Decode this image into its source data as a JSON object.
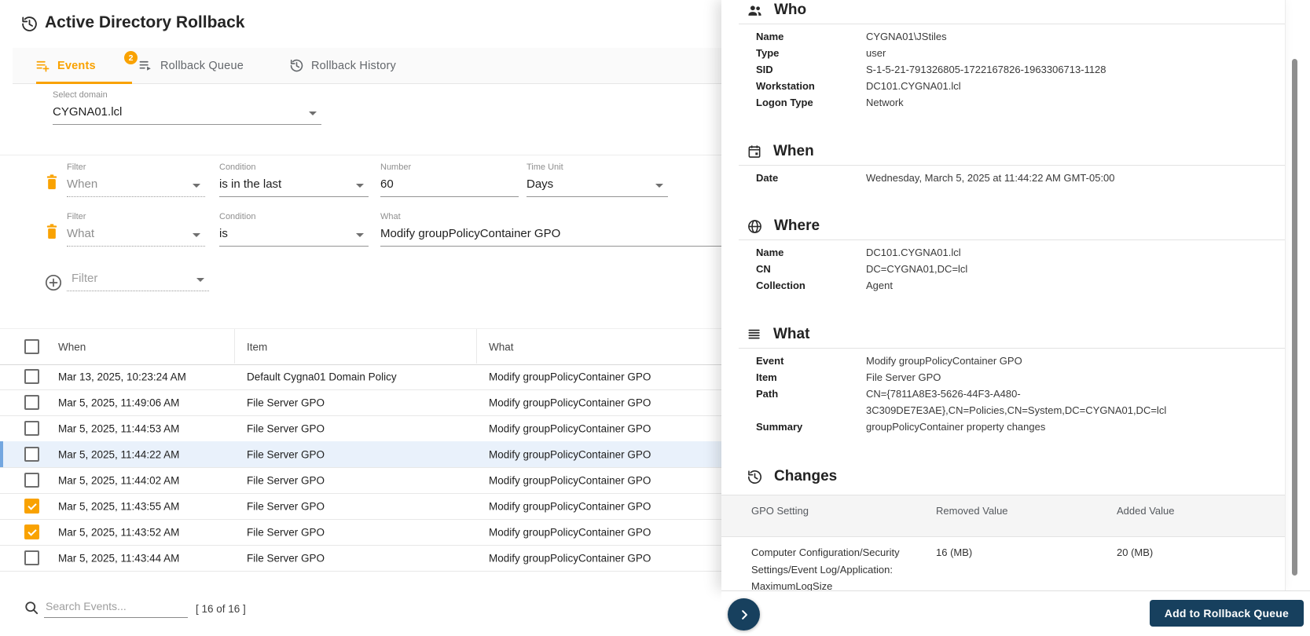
{
  "header": {
    "title": "Active Directory Rollback"
  },
  "tabs": {
    "events": "Events",
    "queue": "Rollback Queue",
    "queue_badge": "2",
    "history": "Rollback History"
  },
  "filters": {
    "domain": {
      "label": "Select domain",
      "value": "CYGNA01.lcl"
    },
    "row1": {
      "filter_label": "Filter",
      "filter_value": "When",
      "condition_label": "Condition",
      "condition_value": "is in the last",
      "number_label": "Number",
      "number_value": "60",
      "unit_label": "Time Unit",
      "unit_value": "Days"
    },
    "row2": {
      "filter_label": "Filter",
      "filter_value": "What",
      "condition_label": "Condition",
      "condition_value": "is",
      "what_label": "What",
      "what_value": "Modify groupPolicyContainer GPO"
    },
    "add_label": "Filter"
  },
  "events": {
    "columns": {
      "when": "When",
      "item": "Item",
      "what": "What"
    },
    "rows": [
      {
        "when": "Mar 13, 2025, 10:23:24 AM",
        "item": "Default Cygna01 Domain Policy",
        "what": "Modify groupPolicyContainer GPO",
        "checked": false,
        "selected": false
      },
      {
        "when": "Mar 5, 2025, 11:49:06 AM",
        "item": "File Server GPO",
        "what": "Modify groupPolicyContainer GPO",
        "checked": false,
        "selected": false
      },
      {
        "when": "Mar 5, 2025, 11:44:53 AM",
        "item": "File Server GPO",
        "what": "Modify groupPolicyContainer GPO",
        "checked": false,
        "selected": false
      },
      {
        "when": "Mar 5, 2025, 11:44:22 AM",
        "item": "File Server GPO",
        "what": "Modify groupPolicyContainer GPO",
        "checked": false,
        "selected": true
      },
      {
        "when": "Mar 5, 2025, 11:44:02 AM",
        "item": "File Server GPO",
        "what": "Modify groupPolicyContainer GPO",
        "checked": false,
        "selected": false
      },
      {
        "when": "Mar 5, 2025, 11:43:55 AM",
        "item": "File Server GPO",
        "what": "Modify groupPolicyContainer GPO",
        "checked": true,
        "selected": false
      },
      {
        "when": "Mar 5, 2025, 11:43:52 AM",
        "item": "File Server GPO",
        "what": "Modify groupPolicyContainer GPO",
        "checked": true,
        "selected": false
      },
      {
        "when": "Mar 5, 2025, 11:43:44 AM",
        "item": "File Server GPO",
        "what": "Modify groupPolicyContainer GPO",
        "checked": false,
        "selected": false
      }
    ],
    "search_placeholder": "Search Events...",
    "count": "[ 16 of 16 ]"
  },
  "details": {
    "who": {
      "heading": "Who",
      "rows": [
        {
          "label": "Name",
          "value": "CYGNA01\\JStiles"
        },
        {
          "label": "Type",
          "value": "user"
        },
        {
          "label": "SID",
          "value": "S-1-5-21-791326805-1722167826-1963306713-1128"
        },
        {
          "label": "Workstation",
          "value": "DC101.CYGNA01.lcl"
        },
        {
          "label": "Logon Type",
          "value": "Network"
        }
      ]
    },
    "when": {
      "heading": "When",
      "rows": [
        {
          "label": "Date",
          "value": "Wednesday, March 5, 2025 at 11:44:22 AM GMT-05:00"
        }
      ]
    },
    "where": {
      "heading": "Where",
      "rows": [
        {
          "label": "Name",
          "value": "DC101.CYGNA01.lcl"
        },
        {
          "label": "CN",
          "value": "DC=CYGNA01,DC=lcl"
        },
        {
          "label": "Collection",
          "value": "Agent"
        }
      ]
    },
    "what": {
      "heading": "What",
      "rows": [
        {
          "label": "Event",
          "value": "Modify groupPolicyContainer GPO"
        },
        {
          "label": "Item",
          "value": "File Server GPO"
        },
        {
          "label": "Path",
          "value": "CN={7811A8E3-5626-44F3-A480-3C309DE7E3AE},CN=Policies,CN=System,DC=CYGNA01,DC=lcl"
        },
        {
          "label": "Summary",
          "value": "groupPolicyContainer property changes"
        }
      ]
    },
    "changes": {
      "heading": "Changes",
      "columns": {
        "setting": "GPO Setting",
        "removed": "Removed Value",
        "added": "Added Value"
      },
      "rows": [
        {
          "setting": "Computer Configuration/Security Settings/Event Log/Application: MaximumLogSize",
          "removed": "16 (MB)",
          "added": "20 (MB)"
        }
      ]
    }
  },
  "footer": {
    "add_button": "Add to Rollback Queue"
  },
  "colors": {
    "accent_orange": "#F9A201",
    "primary_navy": "#17405E",
    "selected_row_bg": "#E9F1FB",
    "selected_row_border": "#74A7E0"
  },
  "icons": {
    "page": "history-icon",
    "tab_events": "list-add-icon",
    "tab_queue": "list-arrow-icon",
    "tab_history": "history-icon",
    "filter_delete": "trash-icon",
    "filter_add": "plus-circle-icon",
    "search": "search-icon",
    "who": "people-icon",
    "when": "calendar-icon",
    "where": "globe-icon",
    "what": "lines-icon",
    "changes": "history-icon",
    "expand": "chevron-right-icon"
  }
}
